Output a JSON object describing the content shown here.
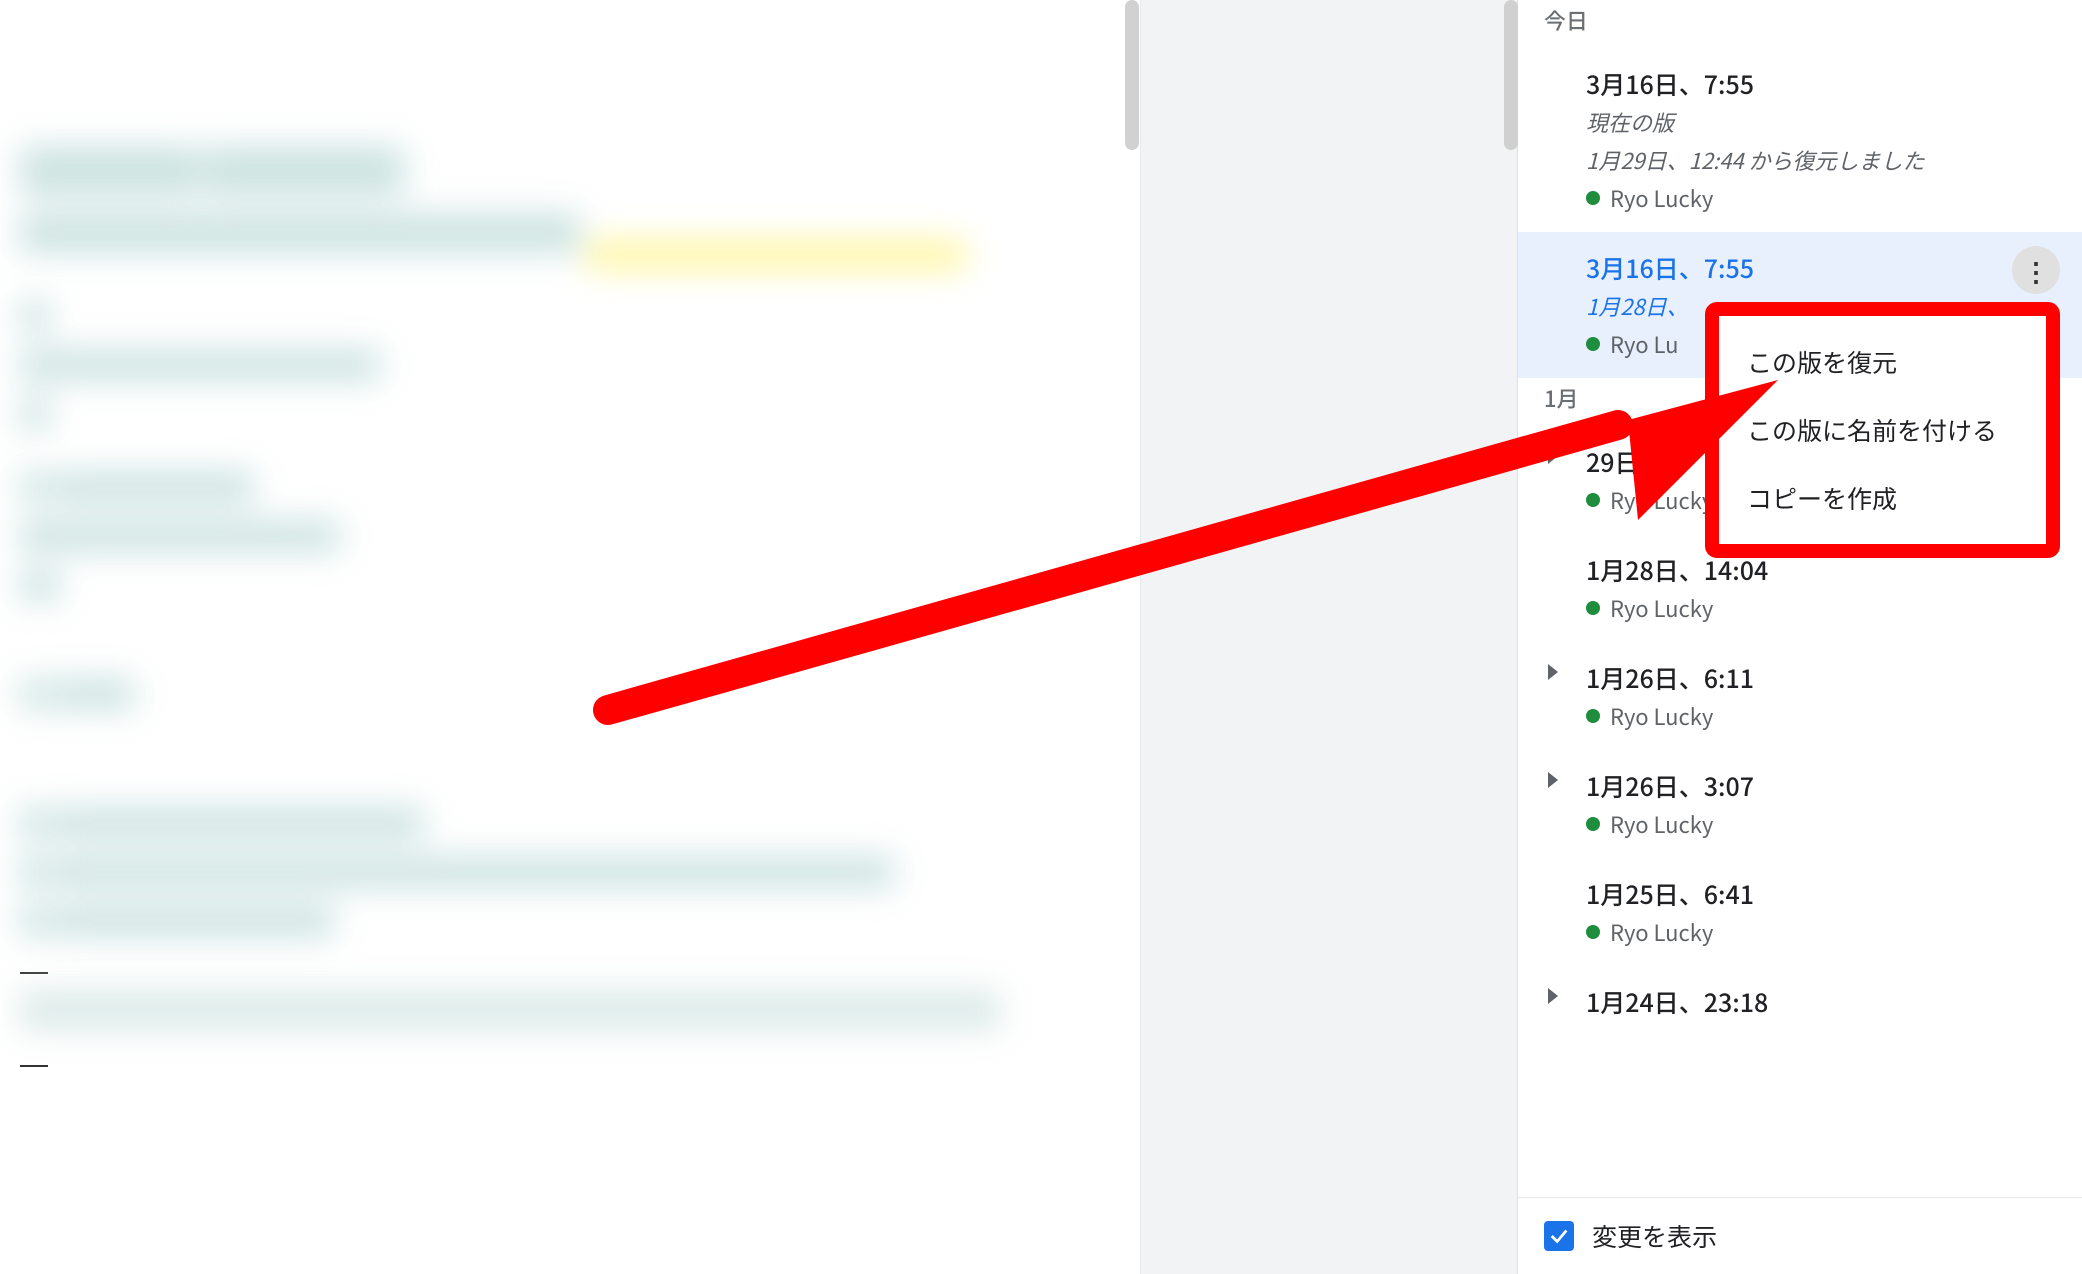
{
  "colors": {
    "author_dot": "#1e8e3e",
    "selected_bg": "#e8f0fe",
    "selected_text": "#1a73e8",
    "highlight_red": "#ff0000"
  },
  "groups": [
    {
      "label": "今日"
    },
    {
      "label": "1月"
    }
  ],
  "versions": [
    {
      "id": "v1",
      "group": 0,
      "title": "3月16日、7:55",
      "subtitle": "現在の版",
      "note": "1月29日、12:44 から復元しました",
      "author": "Ryo Lucky",
      "selected": false,
      "expandable": false
    },
    {
      "id": "v2",
      "group": 0,
      "title": "3月16日、7:55",
      "subtitle": "1月28日、",
      "author": "Ryo Lu",
      "selected": true,
      "expandable": false,
      "has_more": true
    },
    {
      "id": "v3",
      "group": 1,
      "title": "29日",
      "author": "Ryo Lucky",
      "expandable": true
    },
    {
      "id": "v4",
      "group": 1,
      "title": "1月28日、14:04",
      "author": "Ryo Lucky",
      "expandable": false
    },
    {
      "id": "v5",
      "group": 1,
      "title": "1月26日、6:11",
      "author": "Ryo Lucky",
      "expandable": true
    },
    {
      "id": "v6",
      "group": 1,
      "title": "1月26日、3:07",
      "author": "Ryo Lucky",
      "expandable": true
    },
    {
      "id": "v7",
      "group": 1,
      "title": "1月25日、6:41",
      "author": "Ryo Lucky",
      "expandable": false
    },
    {
      "id": "v8",
      "group": 1,
      "title": "1月24日、23:18",
      "author": "",
      "expandable": true,
      "truncated": true
    }
  ],
  "context_menu": {
    "items": [
      "この版を復元",
      "この版に名前を付ける",
      "コピーを作成"
    ]
  },
  "footer": {
    "checkbox_checked": true,
    "label": "変更を表示"
  }
}
